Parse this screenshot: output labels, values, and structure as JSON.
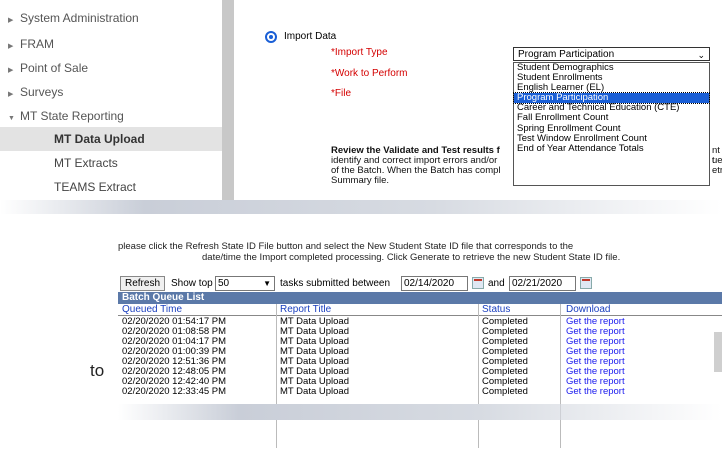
{
  "sidebar": {
    "items": [
      {
        "label": "System Administration",
        "arrow": "▶"
      },
      {
        "label": "FRAM",
        "arrow": "▶"
      },
      {
        "label": "Point of Sale",
        "arrow": "▶"
      },
      {
        "label": "Surveys",
        "arrow": "▶"
      },
      {
        "label": "MT State Reporting",
        "arrow": "▼"
      }
    ],
    "subitems": [
      {
        "label": "MT Data Upload"
      },
      {
        "label": "MT Extracts"
      },
      {
        "label": "TEAMS Extract"
      }
    ]
  },
  "import": {
    "radio_label": "Import Data",
    "import_type_label": "*Import Type",
    "work_label": "*Work to Perform",
    "file_label": "*File",
    "selected_value": "Program Participation",
    "options": [
      "Student Demographics",
      "Student Enrollments",
      "English Learner (EL)",
      "Program Participation",
      "Career and Technical Education (CTE)",
      "Fall Enrollment Count",
      "Spring Enrollment Count",
      "Test Window Enrollment Count",
      "End of Year Attendance Totals"
    ],
    "review_line1_bold": "Review the Validate and Test results f",
    "review_line2": "identify and correct import errors and/or",
    "review_line3": "of the Batch. When the Batch has compl",
    "review_line4": "Summary file.",
    "review_right1": "nt t",
    "review_right2": "ue",
    "review_right3": "etri"
  },
  "batch": {
    "cut_line1": "please click the Refresh State ID File button and select the New Student State ID file that corresponds to the",
    "cut_line2": "date/time the Import completed processing. Click Generate to retrieve the new Student State ID file.",
    "refresh_label": "Refresh",
    "show_top_label": "Show top",
    "show_top_value": "50",
    "tasks_label": "tasks submitted between",
    "date_from": "02/14/2020",
    "and_label": "and",
    "date_to": "02/21/2020",
    "title": "Batch Queue List",
    "columns": [
      "Queued Time",
      "Report Title",
      "Status",
      "Download"
    ],
    "rows": [
      {
        "time": "02/20/2020 01:54:17 PM",
        "title": "MT Data Upload",
        "status": "Completed",
        "download": "Get the report"
      },
      {
        "time": "02/20/2020 01:08:58 PM",
        "title": "MT Data Upload",
        "status": "Completed",
        "download": "Get the report"
      },
      {
        "time": "02/20/2020 01:04:17 PM",
        "title": "MT Data Upload",
        "status": "Completed",
        "download": "Get the report"
      },
      {
        "time": "02/20/2020 01:00:39 PM",
        "title": "MT Data Upload",
        "status": "Completed",
        "download": "Get the report"
      },
      {
        "time": "02/20/2020 12:51:36 PM",
        "title": "MT Data Upload",
        "status": "Completed",
        "download": "Get the report"
      },
      {
        "time": "02/20/2020 12:48:05 PM",
        "title": "MT Data Upload",
        "status": "Completed",
        "download": "Get the report"
      },
      {
        "time": "02/20/2020 12:42:40 PM",
        "title": "MT Data Upload",
        "status": "Completed",
        "download": "Get the report"
      },
      {
        "time": "02/20/2020 12:33:45 PM",
        "title": "MT Data Upload",
        "status": "Completed",
        "download": "Get the report"
      }
    ]
  },
  "caption_fragment": "to",
  "icons": {
    "calendar": "calendar-icon",
    "dropdown": "chevron-down-icon"
  },
  "colors": {
    "accent": "#1a5fd6",
    "required": "#d40000",
    "grid_header": "#5b79a8",
    "link": "#1a1aee"
  }
}
